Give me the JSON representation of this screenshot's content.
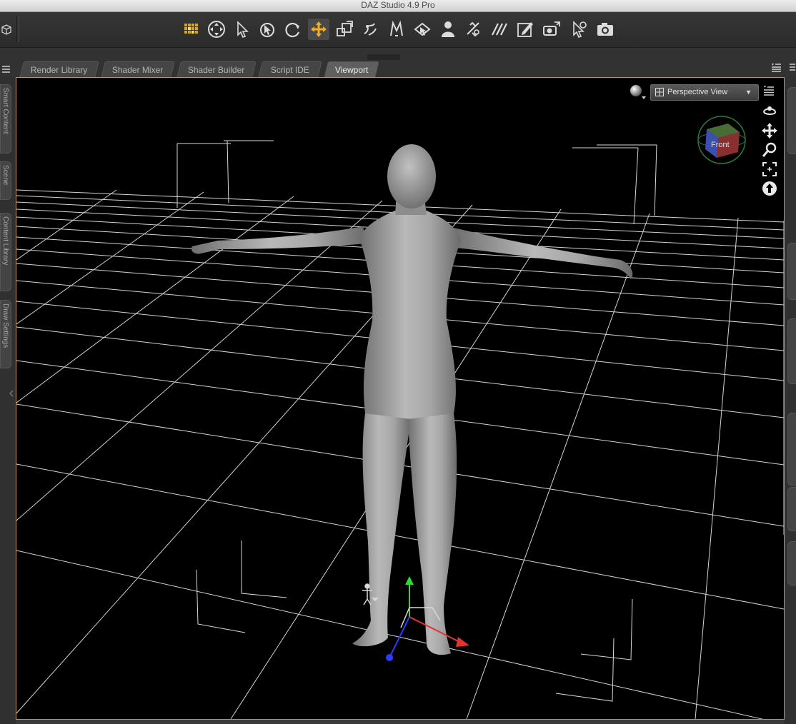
{
  "window": {
    "title": "DAZ Studio 4.9 Pro"
  },
  "toolbar": {
    "tools": [
      {
        "icon": "pixel-grid-icon",
        "active": false
      },
      {
        "icon": "universal-transform-icon",
        "active": false
      },
      {
        "icon": "node-selection-icon",
        "active": false
      },
      {
        "icon": "rotate-selection-icon",
        "active": false
      },
      {
        "icon": "rotate-icon",
        "active": false
      },
      {
        "icon": "translate-icon",
        "active": true
      },
      {
        "icon": "scale-icon",
        "active": false
      },
      {
        "icon": "joint-editor-icon",
        "active": false
      },
      {
        "icon": "morph-icon",
        "active": false
      },
      {
        "icon": "surface-selection-icon",
        "active": false
      },
      {
        "icon": "figure-tool-icon",
        "active": false
      },
      {
        "icon": "geometry-editor-icon",
        "active": false
      },
      {
        "icon": "node-weight-icon",
        "active": false
      },
      {
        "icon": "edit-icon",
        "active": false
      },
      {
        "icon": "render-camera-icon",
        "active": false
      },
      {
        "icon": "spot-render-icon",
        "active": false
      },
      {
        "icon": "render-icon",
        "active": false
      }
    ]
  },
  "tabs": [
    {
      "label": "Render Library"
    },
    {
      "label": "Shader Mixer"
    },
    {
      "label": "Shader Builder"
    },
    {
      "label": "Script IDE"
    },
    {
      "label": "Viewport",
      "active": true
    }
  ],
  "left_panels": [
    "Smart Content",
    "Scene",
    "Content Library",
    "Draw Settings"
  ],
  "viewport": {
    "view_select": {
      "value": "Perspective View"
    },
    "view_cube": {
      "face_label": "Front"
    },
    "nav_icons": [
      "orbit-icon",
      "pan-icon",
      "zoom-icon",
      "frame-icon",
      "reset-view-icon"
    ]
  },
  "colors": {
    "viewport_border": "#b89a55",
    "active_tool": "#f0b020",
    "axis_x": "#e33434",
    "axis_y": "#2fd92f",
    "axis_z": "#2a3cff"
  }
}
